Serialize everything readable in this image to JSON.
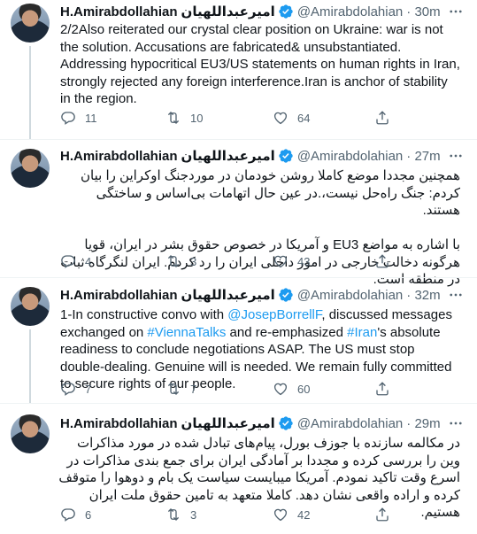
{
  "tweets": [
    {
      "name": "H.Amirabdollahian",
      "name_fa": "امیرعبداللهیان",
      "handle": "@Amirabdolahian",
      "time": "· 30m",
      "text": "2/2Also reiterated our crystal clear position on Ukraine: war is not the solution. Accusations are fabricated& unsubstantiated.\nAddressing hypocritical EU3/US statements on human rights in Iran, strongly rejected any foreign interference.Iran is anchor of stability in the region.",
      "replies": "11",
      "retweets": "10",
      "likes": "64"
    },
    {
      "name": "H.Amirabdollahian",
      "name_fa": "امیرعبداللهیان",
      "handle": "@Amirabdolahian",
      "time": "· 27m",
      "text": "همچنین مجددا موضع کاملا روشن خودمان در موردجنگ اوکراین را بیان کردم: جنگ راه‌حل نیست،.در عین حال اتهامات بی‌اساس و ساختگی هستند.\n\nبا اشاره به مواضع EU3 و آمریکا در خصوص حقوق بشر در ایران، قویا هرگونه دخالت خارجی در امور داخلی ایران را رد کردم. ایران لنگرگاه ثبات در منطقه است.",
      "replies": "4",
      "retweets": "3",
      "likes": "43"
    },
    {
      "name": "H.Amirabdollahian",
      "name_fa": "امیرعبداللهیان",
      "handle": "@Amirabdolahian",
      "time": "· 32m",
      "text_parts": [
        "1-In constructive convo with ",
        "@JosepBorrellF",
        ", discussed messages exchanged on ",
        "#ViennaTalks",
        " and re-emphasized ",
        "#Iran",
        "'s absolute readiness to conclude negotiations ASAP. The US must stop double-dealing. Genuine will is needed. We remain fully committed to secure rights of our people."
      ],
      "replies": "7",
      "retweets": "7",
      "likes": "60"
    },
    {
      "name": "H.Amirabdollahian",
      "name_fa": "امیرعبداللهیان",
      "handle": "@Amirabdolahian",
      "time": "· 29m",
      "text": "در مکالمه سازنده با جوزف بورل، پیام‌های تبادل شده در مورد مذاکرات وین را بررسی کرده و مجددا بر آمادگی ایران برای جمع بندی مذاکرات در اسرع وقت تاکید نمودم. آمریکا میبایست سیاست یک بام و دوهوا را متوقف کرده و اراده واقعی نشان دهد. کاملا متعهد به تامین حقوق ملت ایران هستیم.",
      "replies": "6",
      "retweets": "3",
      "likes": "42"
    }
  ],
  "colors": {
    "accent": "#1d9bf0",
    "muted": "#536471",
    "text": "#0f1419",
    "border": "#eff3f4"
  },
  "icons": {
    "verified": "verified-badge-icon",
    "reply": "reply-icon",
    "retweet": "retweet-icon",
    "like": "heart-icon",
    "share": "share-icon",
    "more": "more-icon"
  }
}
